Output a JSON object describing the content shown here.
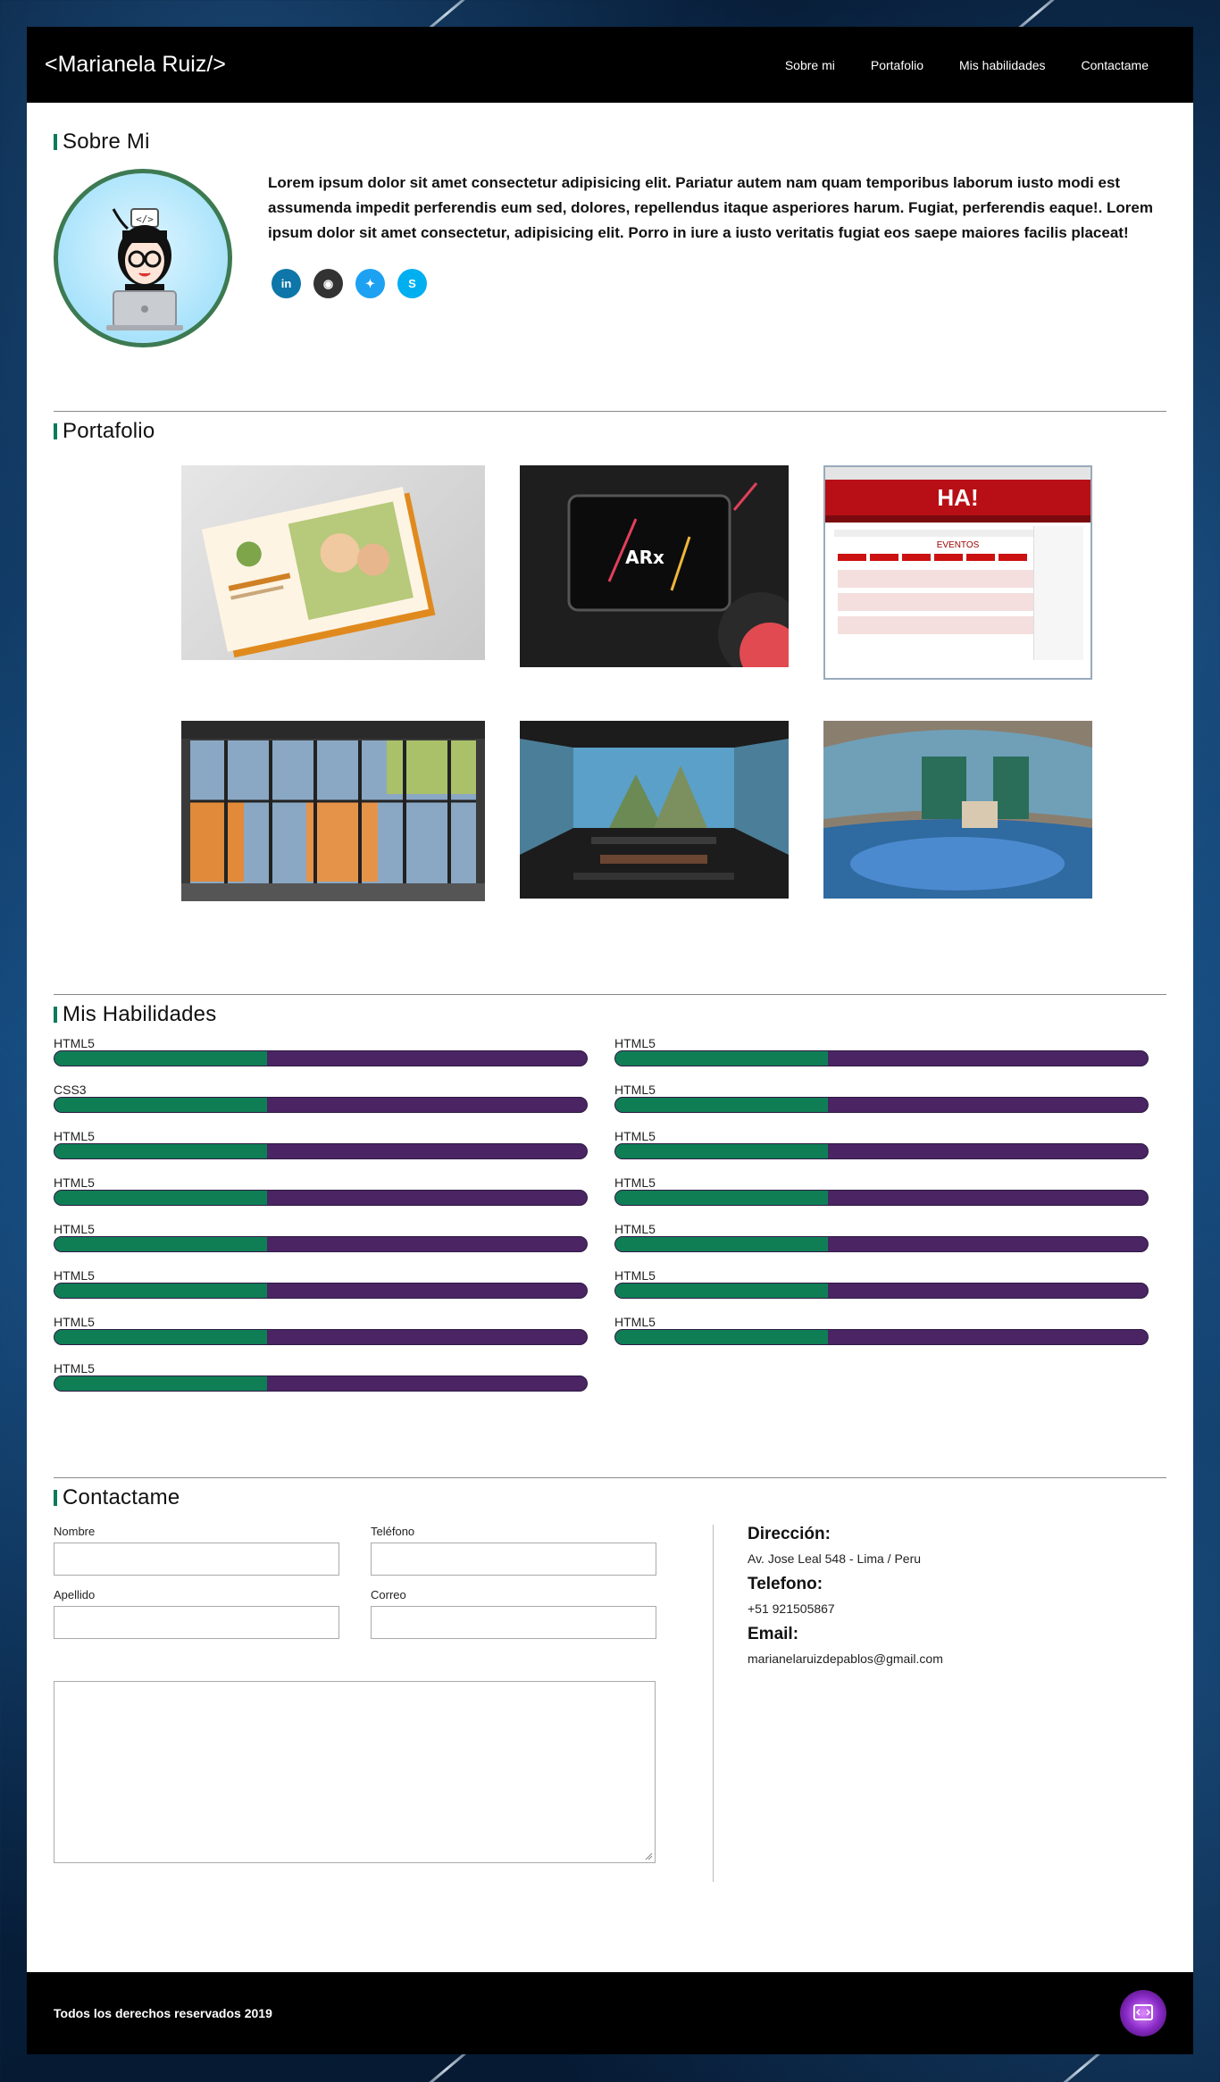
{
  "header": {
    "logo": "<Marianela Ruiz/>",
    "nav": [
      "Sobre mi",
      "Portafolio",
      "Mis habilidades",
      "Contactame"
    ]
  },
  "about": {
    "title": "Sobre Mi",
    "text": "Lorem ipsum dolor sit amet consectetur adipisicing elit. Pariatur autem nam quam temporibus laborum iusto modi est assumenda impedit perferendis eum sed, dolores, repellendus itaque asperiores harum. Fugiat, perferendis eaque!. Lorem ipsum dolor sit amet consectetur, adipisicing elit. Porro in iure a iusto veritatis fugiat eos saepe maiores facilis placeat!",
    "socials": [
      {
        "icon": "linkedin-icon",
        "glyph": "in",
        "color": "#0e76a8"
      },
      {
        "icon": "github-icon",
        "glyph": "◉",
        "color": "#333333"
      },
      {
        "icon": "twitter-icon",
        "glyph": "✦",
        "color": "#1da1f2"
      },
      {
        "icon": "skype-icon",
        "glyph": "S",
        "color": "#00aff0"
      }
    ]
  },
  "portfolio": {
    "title": "Portafolio",
    "thumb3": {
      "logo": "HA!",
      "heading": "EVENTOS"
    }
  },
  "skills": {
    "title": "Mis Habilidades",
    "left": [
      {
        "label": "HTML5",
        "level": 0.4
      },
      {
        "label": "CSS3",
        "level": 0.4
      },
      {
        "label": "HTML5",
        "level": 0.4
      },
      {
        "label": "HTML5",
        "level": 0.4
      },
      {
        "label": "HTML5",
        "level": 0.4
      },
      {
        "label": "HTML5",
        "level": 0.4
      },
      {
        "label": "HTML5",
        "level": 0.4
      },
      {
        "label": "HTML5",
        "level": 0.4
      }
    ],
    "right": [
      {
        "label": "HTML5",
        "level": 0.4
      },
      {
        "label": "HTML5",
        "level": 0.4
      },
      {
        "label": "HTML5",
        "level": 0.4
      },
      {
        "label": "HTML5",
        "level": 0.4
      },
      {
        "label": "HTML5",
        "level": 0.4
      },
      {
        "label": "HTML5",
        "level": 0.4
      },
      {
        "label": "HTML5",
        "level": 0.4
      }
    ]
  },
  "contact": {
    "title": "Contactame",
    "fields": {
      "nombre": "Nombre",
      "telefono": "Teléfono",
      "apellido": "Apellido",
      "correo": "Correo"
    },
    "info": {
      "address_label": "Dirección:",
      "address": "Av. Jose Leal 548 - Lima / Peru",
      "phone_label": "Telefono:",
      "phone": "+51 921505867",
      "email_label": "Email:",
      "email": "marianelaruizdepablos@gmail.com"
    }
  },
  "footer": {
    "copyright": "Todos los derechos reservados 2019"
  }
}
